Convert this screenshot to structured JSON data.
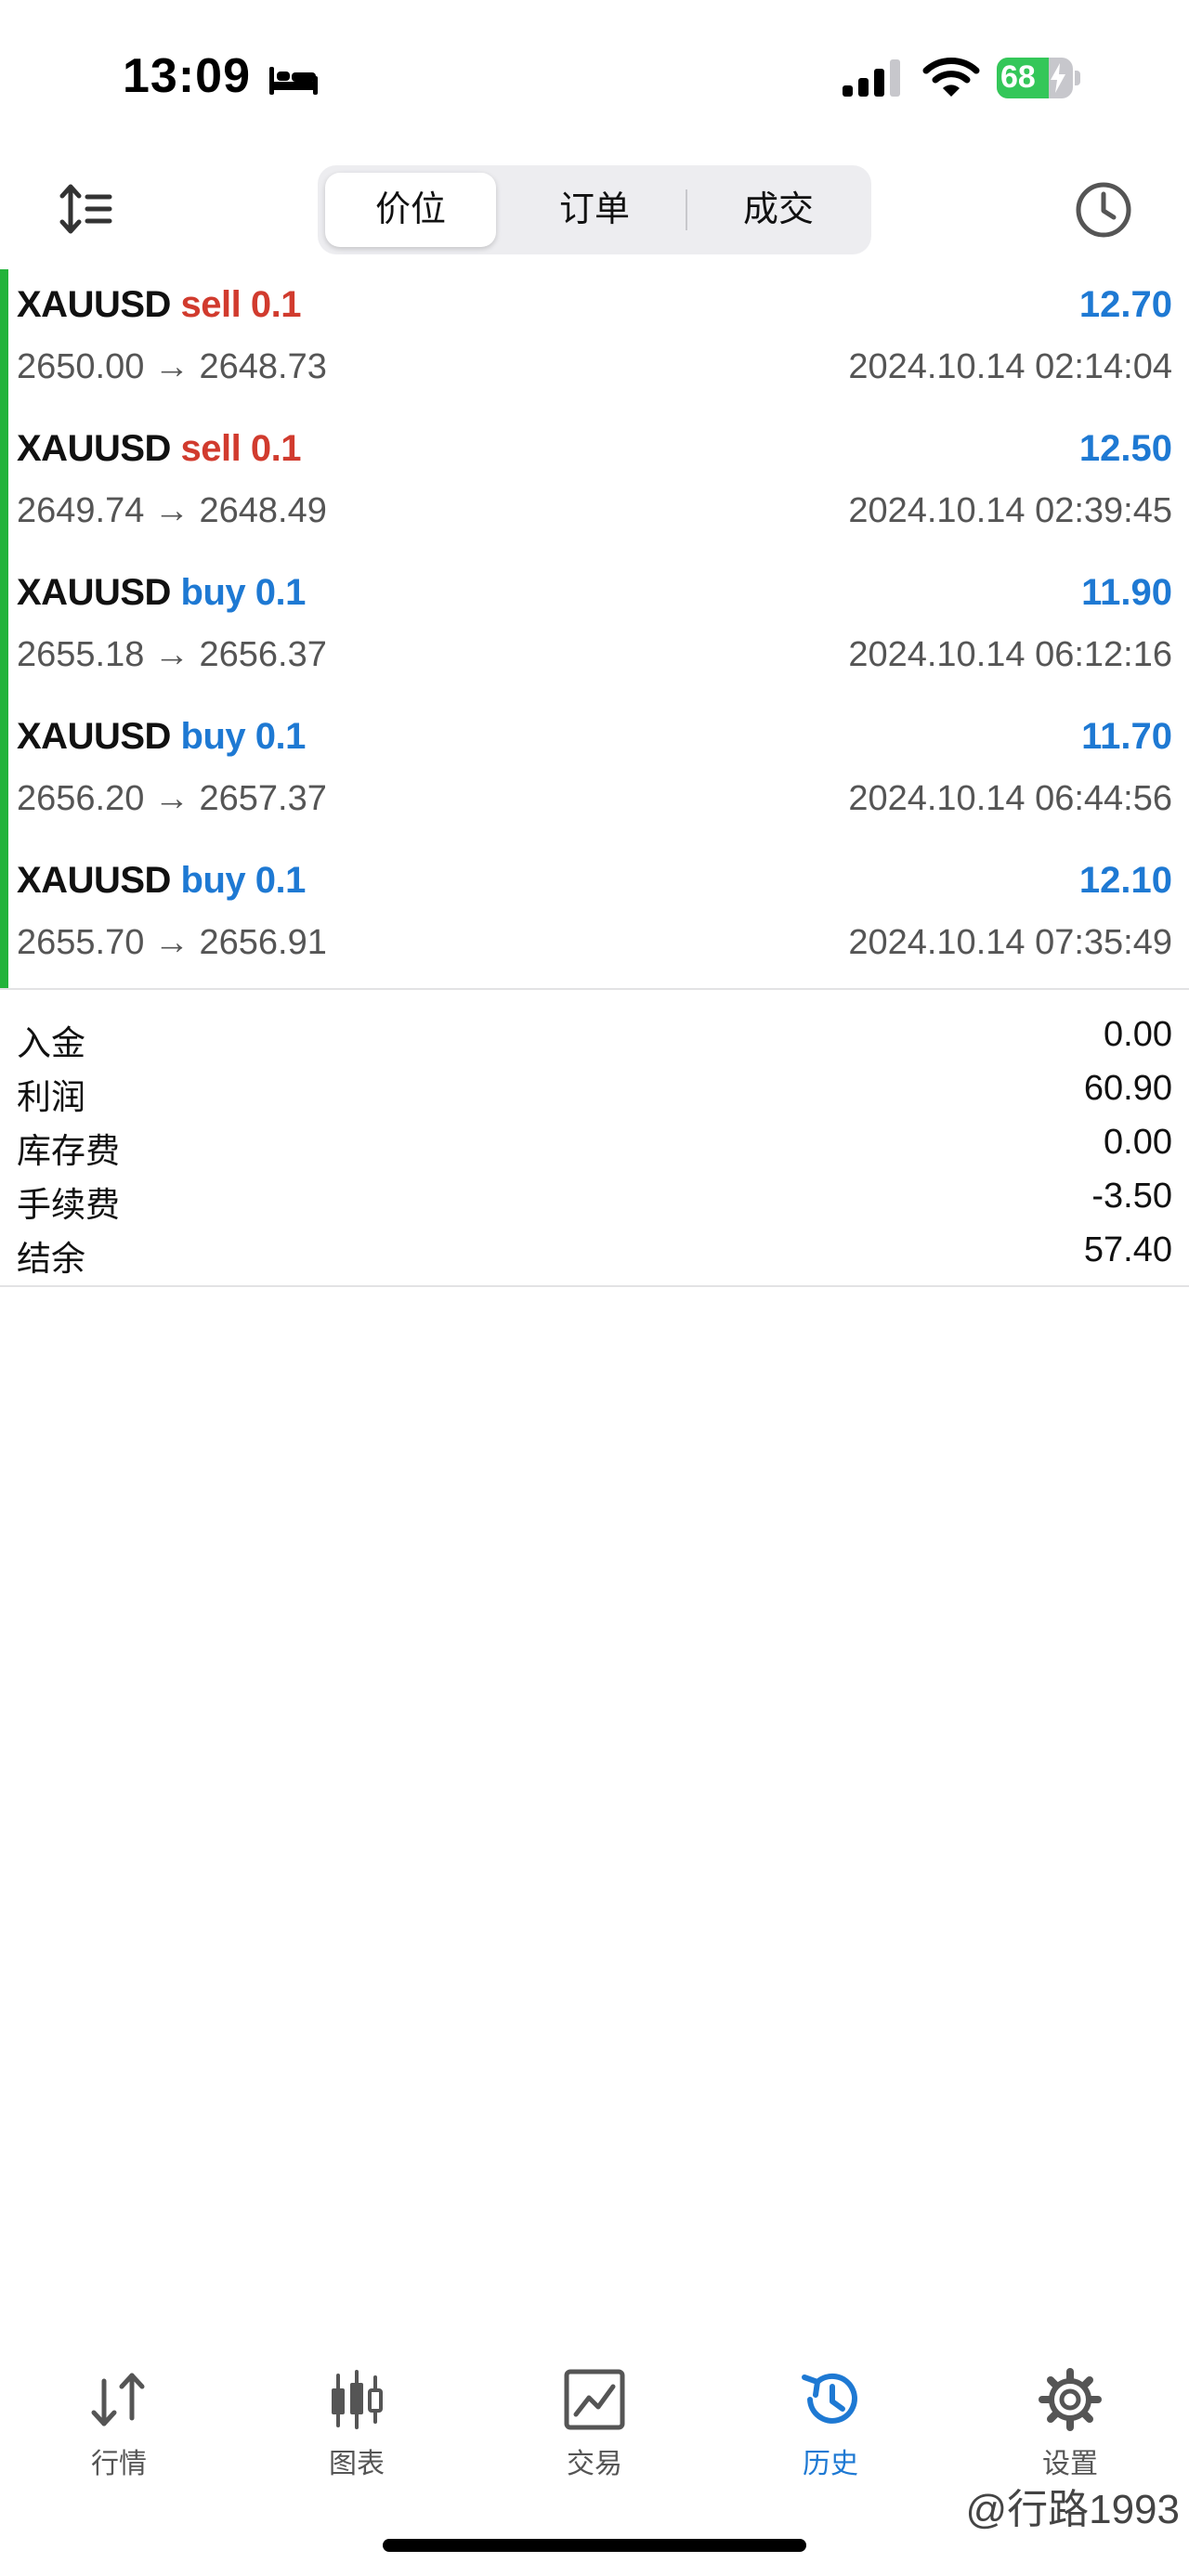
{
  "status": {
    "time": "13:09",
    "battery": "68",
    "battery_level": 0.68,
    "icons": [
      "bed-icon",
      "signal-icon",
      "wifi-icon",
      "battery-icon"
    ]
  },
  "header": {
    "segments": [
      {
        "label": "价位",
        "active": true
      },
      {
        "label": "订单",
        "active": false
      },
      {
        "label": "成交",
        "active": false
      }
    ],
    "left_icon": "sort-icon",
    "right_icon": "history-clock-icon"
  },
  "deals": [
    {
      "symbol": "XAUUSD",
      "side": "sell 0.1",
      "profit": "12.70",
      "prices": "2650.00 → 2648.73",
      "time": "2024.10.14 02:14:04"
    },
    {
      "symbol": "XAUUSD",
      "side": "sell 0.1",
      "profit": "12.50",
      "prices": "2649.74 → 2648.49",
      "time": "2024.10.14 02:39:45"
    },
    {
      "symbol": "XAUUSD",
      "side": "buy 0.1",
      "profit": "11.90",
      "prices": "2655.18 → 2656.37",
      "time": "2024.10.14 06:12:16"
    },
    {
      "symbol": "XAUUSD",
      "side": "buy 0.1",
      "profit": "11.70",
      "prices": "2656.20 → 2657.37",
      "time": "2024.10.14 06:44:56"
    },
    {
      "symbol": "XAUUSD",
      "side": "buy 0.1",
      "profit": "12.10",
      "prices": "2655.70 → 2656.91",
      "time": "2024.10.14 07:35:49"
    }
  ],
  "summary": [
    {
      "label": "入金",
      "value": "0.00"
    },
    {
      "label": "利润",
      "value": "60.90"
    },
    {
      "label": "库存费",
      "value": "0.00"
    },
    {
      "label": "手续费",
      "value": "-3.50"
    },
    {
      "label": "结余",
      "value": "57.40"
    }
  ],
  "tabbar": [
    {
      "label": "行情",
      "icon": "quotes-arrows-icon",
      "active": false
    },
    {
      "label": "图表",
      "icon": "candlestick-chart-icon",
      "active": false
    },
    {
      "label": "交易",
      "icon": "trade-chart-icon",
      "active": false
    },
    {
      "label": "历史",
      "icon": "history-clock-icon",
      "active": true
    },
    {
      "label": "设置",
      "icon": "gear-icon",
      "active": false
    }
  ],
  "watermark": "@行路1993",
  "colors": {
    "sell": "#d13b2e",
    "buy": "#1e79d3",
    "profit": "#1e79d3",
    "green_bar": "#22b33a",
    "active_tab": "#1e79d3",
    "battery_green": "#34c759"
  }
}
